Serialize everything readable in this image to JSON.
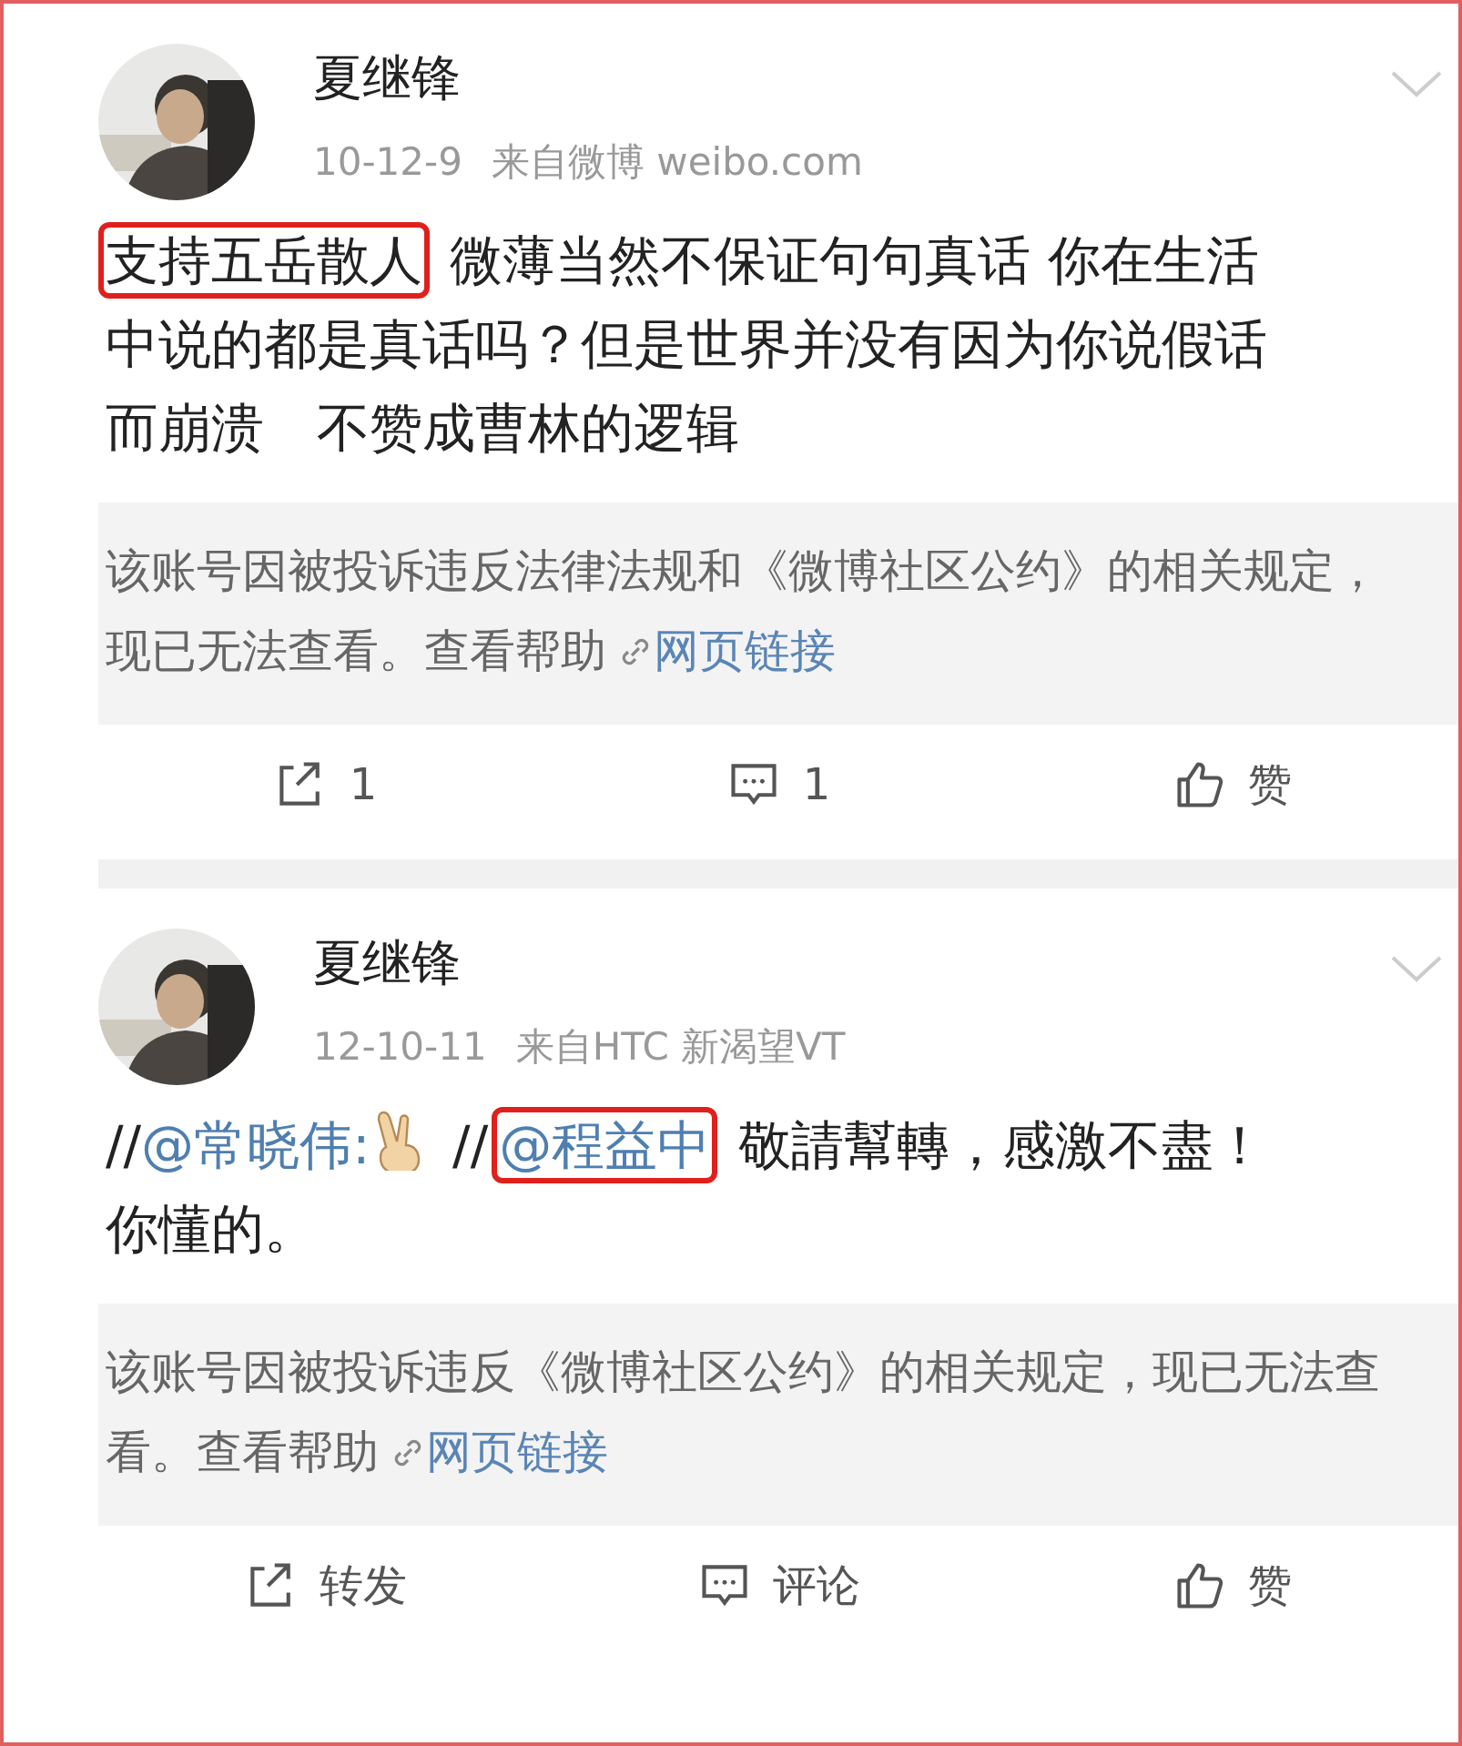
{
  "posts": [
    {
      "author": "夏继锋",
      "date": "10-12-9",
      "source": "来自微博 weibo.com",
      "body": [
        {
          "kind": "text",
          "text": "支持五岳散人",
          "highlighted": true
        },
        {
          "kind": "text",
          "text": " 微薄当然不保证句句真话 你在生活中说的都是真话吗？但是世界并没有因为你说假话而崩溃　不赞成曹林的逻辑",
          "highlighted": false
        }
      ],
      "notice": {
        "text": "该账号因被投诉违反法律法规和《微博社区公约》的相关规定，现已无法查看。查看帮助",
        "link": "网页链接"
      },
      "actions": [
        {
          "kind": "repost",
          "label": "1"
        },
        {
          "kind": "comment",
          "label": "1"
        },
        {
          "kind": "like",
          "label": "赞"
        }
      ]
    },
    {
      "author": "夏继锋",
      "date": "12-10-11",
      "source": "来自HTC 新渴望VT",
      "body": [
        {
          "kind": "text",
          "text": "//",
          "highlighted": false
        },
        {
          "kind": "mention",
          "text": "@常晓伟:",
          "highlighted": false
        },
        {
          "kind": "victory-emoji",
          "highlighted": false
        },
        {
          "kind": "text",
          "text": " //",
          "highlighted": false
        },
        {
          "kind": "mention",
          "text": "@程益中",
          "highlighted": true
        },
        {
          "kind": "text",
          "text": " 敬請幫轉，感激不盡！你懂的。",
          "highlighted": false
        }
      ],
      "notice": {
        "text": "该账号因被投诉违反《微博社区公约》的相关规定，现已无法查看。查看帮助",
        "link": "网页链接"
      },
      "actions": [
        {
          "kind": "repost",
          "label": "转发"
        },
        {
          "kind": "comment",
          "label": "评论"
        },
        {
          "kind": "like",
          "label": "赞"
        }
      ]
    }
  ]
}
